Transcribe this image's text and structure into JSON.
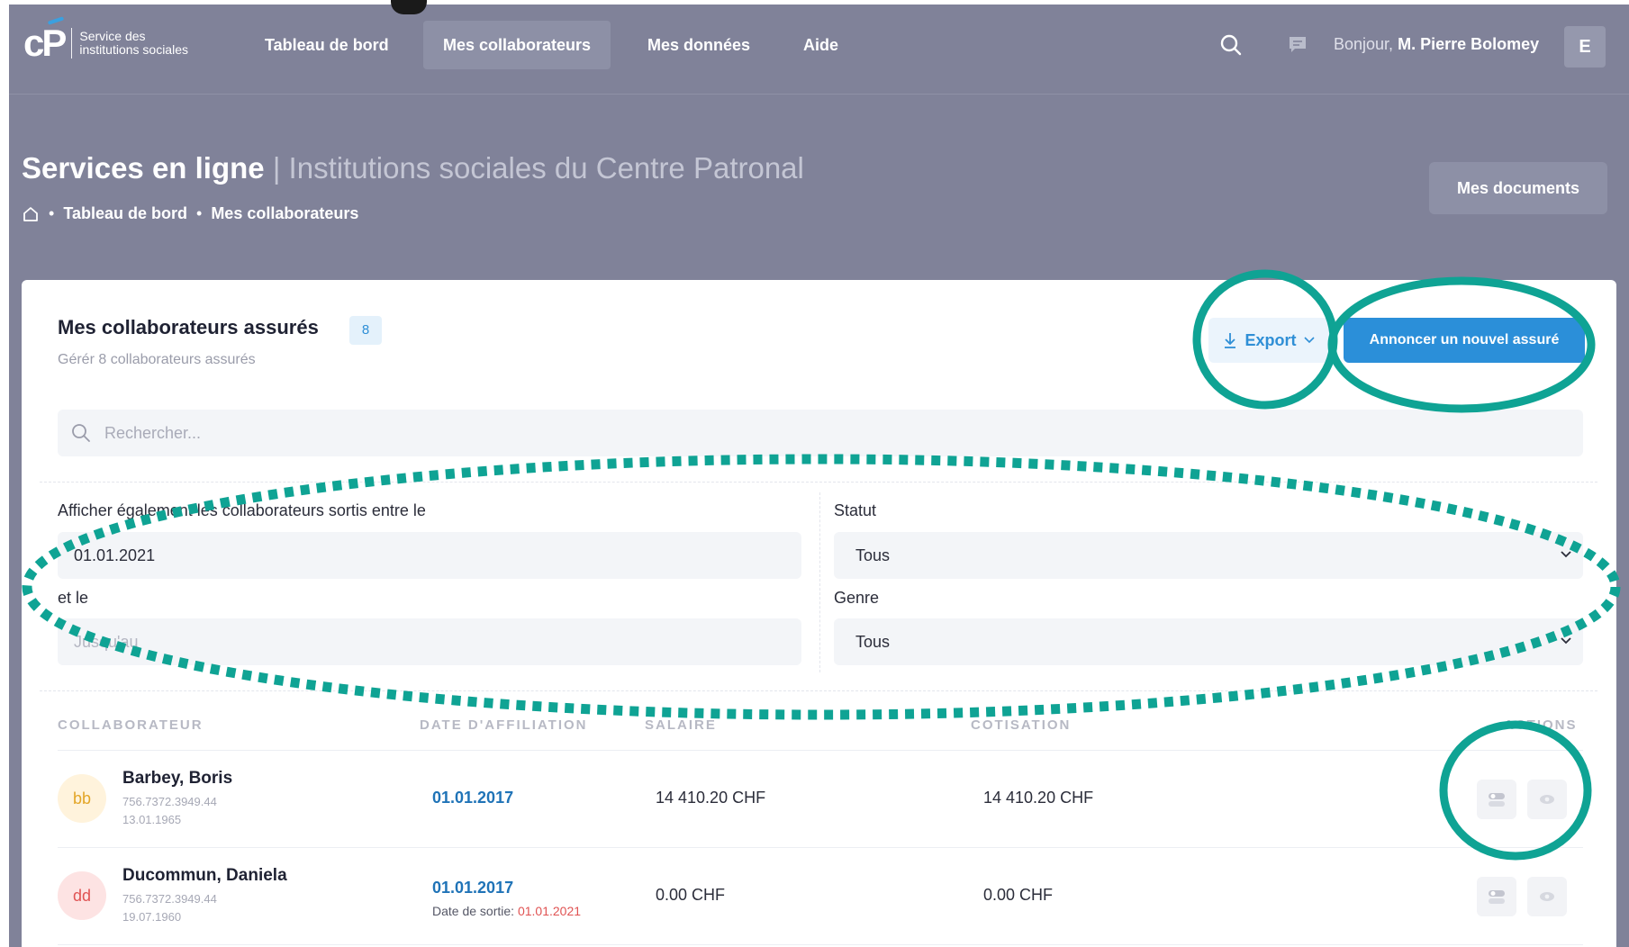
{
  "logo": {
    "mark": "cP",
    "line1": "Service des",
    "line2": "institutions sociales"
  },
  "nav": {
    "items": [
      {
        "label": "Tableau de bord",
        "active": false
      },
      {
        "label": "Mes collaborateurs",
        "active": true
      },
      {
        "label": "Mes données",
        "active": false
      },
      {
        "label": "Aide",
        "active": false
      }
    ],
    "greeting_prefix": "Bonjour,",
    "user_name": "M. Pierre Bolomey",
    "avatar_letter": "E"
  },
  "header": {
    "title": "Services en ligne",
    "subtitle": "| Institutions sociales du Centre Patronal",
    "breadcrumb": [
      "Tableau de bord",
      "Mes collaborateurs"
    ],
    "docs_button": "Mes documents"
  },
  "card": {
    "title": "Mes collaborateurs assurés",
    "count": "8",
    "subtitle": "Gérér 8 collaborateurs assurés",
    "export_label": "Export",
    "new_button": "Annoncer un nouvel assuré",
    "search_placeholder": "Rechercher..."
  },
  "filters": {
    "date_label": "Afficher également les collaborateurs sortis entre le",
    "date_from": "01.01.2021",
    "date_to_label": "et le",
    "date_to_placeholder": "Jusqu'au",
    "status_label": "Statut",
    "status_value": "Tous",
    "gender_label": "Genre",
    "gender_value": "Tous"
  },
  "table": {
    "headers": {
      "collaborator": "COLLABORATEUR",
      "affiliation": "DATE D'AFFILIATION",
      "salary": "SALAIRE",
      "contribution": "COTISATION",
      "actions": "ACTIONS"
    },
    "rows": [
      {
        "initials": "bb",
        "name": "Barbey, Boris",
        "avs": "756.7372.3949.44",
        "birth": "13.01.1965",
        "affiliation": "01.01.2017",
        "exit_label": "",
        "exit_date": "",
        "salary": "14 410.20 CHF",
        "contribution": "14 410.20 CHF"
      },
      {
        "initials": "dd",
        "name": "Ducommun, Daniela",
        "avs": "756.7372.3949.44",
        "birth": "19.07.1960",
        "affiliation": "01.01.2017",
        "exit_label": "Date de sortie:",
        "exit_date": "01.01.2021",
        "salary": "0.00 CHF",
        "contribution": "0.00 CHF"
      }
    ]
  },
  "colors": {
    "nav_bg": "#808299",
    "accent_blue": "#2b8fd9",
    "annotation_teal": "#0fa394",
    "avatar_bb_bg": "#fff3dc",
    "avatar_bb_fg": "#e3a628",
    "avatar_dd_bg": "#fde3e3",
    "avatar_dd_fg": "#e05353",
    "exit_date_red": "#e05353"
  },
  "icons": [
    "search-icon",
    "chat-icon",
    "home-icon",
    "download-icon",
    "chevron-down-icon",
    "toggle-icon",
    "eye-icon"
  ]
}
